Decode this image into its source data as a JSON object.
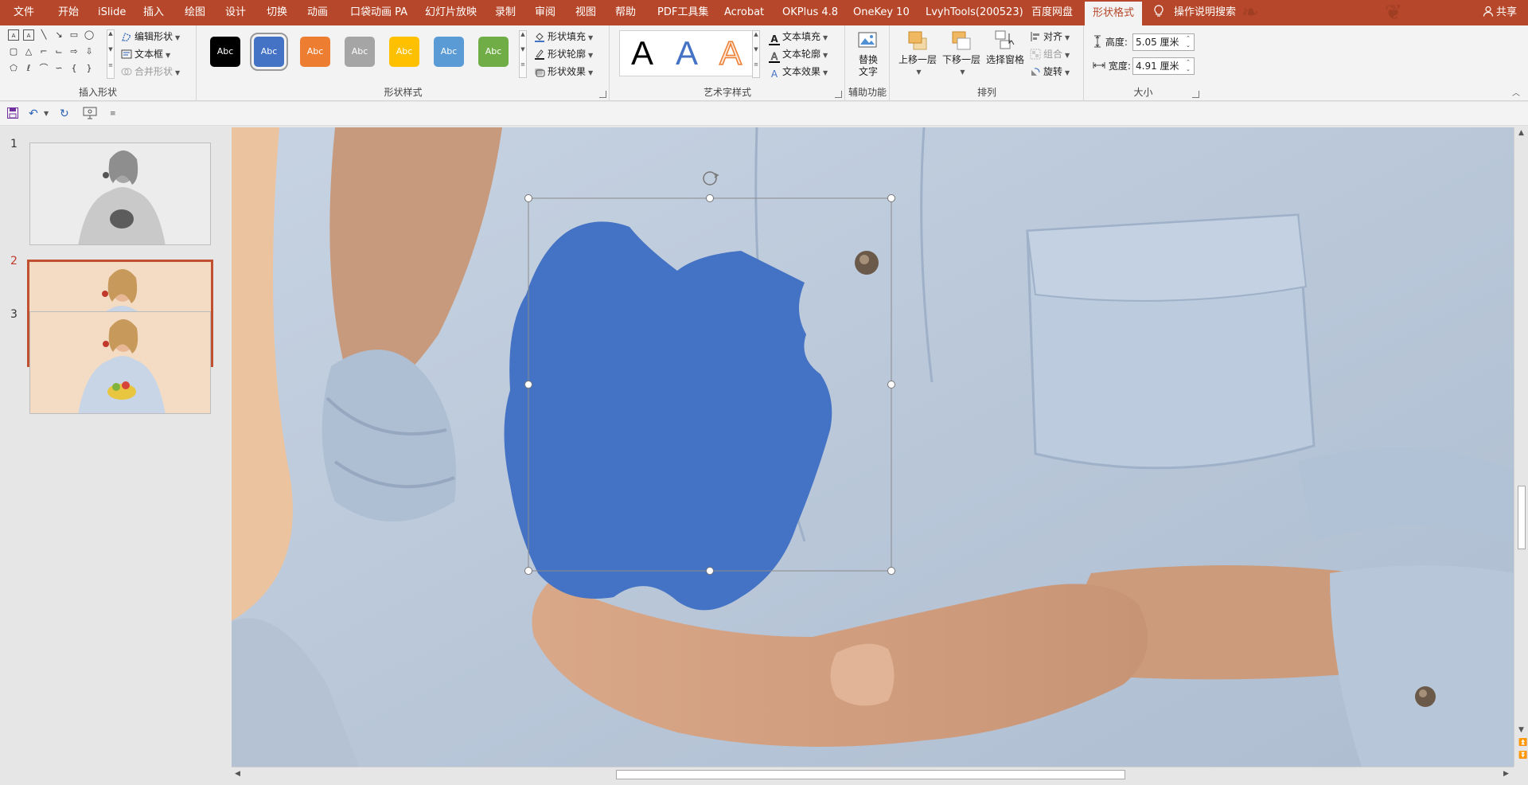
{
  "menubar": {
    "tabs": [
      "文件",
      "开始",
      "iSlide",
      "插入",
      "绘图",
      "设计",
      "切换",
      "动画",
      "口袋动画 PA",
      "幻灯片放映",
      "录制",
      "审阅",
      "视图",
      "帮助",
      "PDF工具集",
      "Acrobat",
      "OKPlus 4.8",
      "OneKey 10",
      "LvyhTools(200523)",
      "百度网盘",
      "形状格式"
    ],
    "active_tab": "形状格式",
    "tell_me": "操作说明搜索",
    "share": "共享",
    "bar_color": "#b7472a"
  },
  "ribbon": {
    "insert_shapes": {
      "label": "插入形状",
      "edit_shape": "编辑形状",
      "text_box": "文本框",
      "merge_shapes": "合并形状"
    },
    "shape_styles": {
      "label": "形状样式",
      "tile_text": "Abc",
      "tile_colors": [
        "#000000",
        "#4472c4",
        "#ed7d31",
        "#a5a5a5",
        "#ffc000",
        "#5b9bd5",
        "#70ad47"
      ],
      "fill": "形状填充",
      "outline": "形状轮廓",
      "effects": "形状效果"
    },
    "wordart": {
      "label": "艺术字样式",
      "letters": [
        "A",
        "A",
        "A"
      ],
      "text_fill": "文本填充",
      "text_outline": "文本轮廓",
      "text_effects": "文本效果"
    },
    "accessibility": {
      "label": "辅助功能",
      "alt_text_line1": "替换",
      "alt_text_line2": "文字"
    },
    "arrange": {
      "label": "排列",
      "bring_forward": "上移一层",
      "send_backward": "下移一层",
      "selection_pane": "选择窗格",
      "align": "对齐",
      "group": "组合",
      "rotate": "旋转"
    },
    "size": {
      "label": "大小",
      "height_label": "高度:",
      "height_value": "5.05 厘米",
      "width_label": "宽度:",
      "width_value": "4.91 厘米"
    }
  },
  "slides": {
    "numbers": [
      "1",
      "2",
      "3"
    ],
    "active": 2
  },
  "canvas": {
    "selected_shape_color": "#4472c4"
  }
}
